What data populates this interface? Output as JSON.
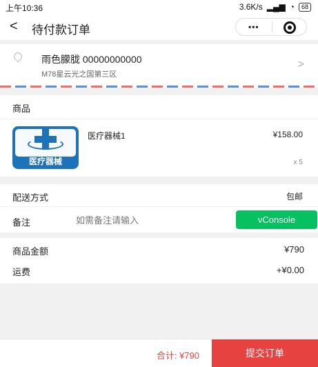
{
  "status_bar": {
    "time": "上午10:36",
    "network_speed": "3.6K/s",
    "battery": "68"
  },
  "nav": {
    "back_icon": "chevron-left-icon",
    "title": "待付款订单",
    "menu_icon": "more-dots-icon",
    "close_icon": "target-circle-icon"
  },
  "address": {
    "icon": "location-pin-icon",
    "name_phone": "雨色朦胧 00000000000",
    "detail": "M78星云光之国第三区",
    "arrow": ">"
  },
  "goods": {
    "header": "商品",
    "item": {
      "image_label": "医疗器械",
      "name": "医疗器械1",
      "price": "¥158.00",
      "quantity": "x 5"
    }
  },
  "delivery": {
    "label": "配送方式",
    "value": "包邮"
  },
  "remark": {
    "label": "备注",
    "placeholder": "如需备注请输入"
  },
  "vconsole": {
    "label": "vConsole"
  },
  "amounts": {
    "goods_label": "商品金额",
    "goods_value": "¥790",
    "shipping_label": "运费",
    "shipping_value": "+¥0.00"
  },
  "bottom_bar": {
    "total": "合计: ¥790",
    "submit": "提交订单"
  },
  "colors": {
    "accent": "#e64340",
    "vconsole_green": "#07c160",
    "brand_blue": "#1e72b8"
  }
}
